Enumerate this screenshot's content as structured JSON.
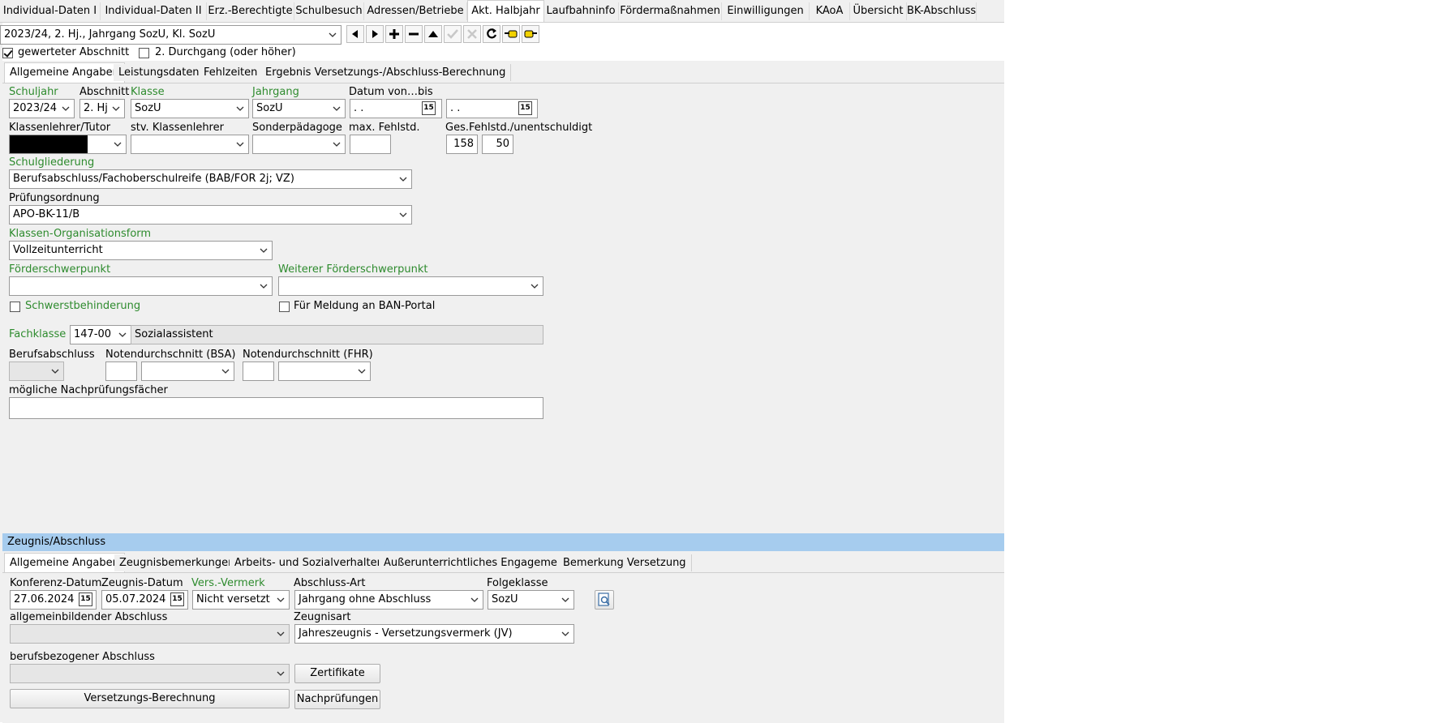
{
  "top_tabs": [
    "Individual-Daten I",
    "Individual-Daten II",
    "Erz.-Berechtigte",
    "Schulbesuch",
    "Adressen/Betriebe",
    "Akt. Halbjahr",
    "Laufbahninfo",
    "Fördermaßnahmen",
    "Einwilligungen",
    "KAoA",
    "Übersicht",
    "BK-Abschluss"
  ],
  "active_top_tab": "Akt. Halbjahr",
  "period_select": "2023/24, 2. Hj., Jahrgang SozU, Kl. SozU",
  "checks": {
    "gewerteter_label": "gewerteter Abschnitt",
    "gewerteter_checked": true,
    "durchgang_label": "2. Durchgang (oder höher)",
    "durchgang_checked": false
  },
  "sub_tabs": [
    "Allgemeine Angaben",
    "Leistungsdaten",
    "Fehlzeiten",
    "Ergebnis Versetzungs-/Abschluss-Berechnung"
  ],
  "general": {
    "schuljahr_label": "Schuljahr",
    "schuljahr": "2023/24",
    "abschnitt_label": "Abschnitt",
    "abschnitt": "2. Hj",
    "klasse_label": "Klasse",
    "klasse": "SozU",
    "jahrgang_label": "Jahrgang",
    "jahrgang": "SozU",
    "datum_label": "Datum von…bis",
    "datum_von": " .  .",
    "datum_bis": " .  .",
    "klassenlehrer_label": "Klassenlehrer/Tutor",
    "stv_label": "stv. Klassenlehrer",
    "sonder_label": "Sonderpädagoge",
    "maxfehl_label": "max. Fehlstd.",
    "gesfehl_label": "Ges.Fehlstd./unentschuldigt",
    "gesfehl": "158",
    "unentschuldigt": "50",
    "schulgliederung_label": "Schulgliederung",
    "schulgliederung": "Berufsabschluss/Fachoberschulreife (BAB/FOR 2j; VZ)",
    "pruefungsordnung_label": "Prüfungsordnung",
    "pruefungsordnung": "APO-BK-11/B",
    "orgform_label": "Klassen-Organisationsform",
    "orgform": "Vollzeitunterricht",
    "foerder_label": "Förderschwerpunkt",
    "weiterer_foerder_label": "Weiterer Förderschwerpunkt",
    "schwerst_label": "Schwerstbehinderung",
    "ban_label": "Für Meldung an BAN-Portal",
    "fachklasse_label": "Fachklasse",
    "fachklasse_code": "147-00",
    "fachklasse_name": "Sozialassistent",
    "berufsabschluss_label": "Berufsabschluss",
    "notenbsa_label": "Notendurchschnitt (BSA)",
    "notenfhr_label": "Notendurchschnitt (FHR)",
    "nachpruef_label": "mögliche Nachprüfungsfächer"
  },
  "zeugnis": {
    "header": "Zeugnis/Abschluss",
    "tabs": [
      "Allgemeine Angaben",
      "Zeugnisbemerkungen",
      "Arbeits- und Sozialverhalten",
      "Außerunterrichtliches Engagement",
      "Bemerkung Versetzung"
    ],
    "konferenz_label": "Konferenz-Datum",
    "konferenz": "27.06.2024",
    "zeugnisdatum_label": "Zeugnis-Datum",
    "zeugnisdatum": "05.07.2024",
    "vermerk_label": "Vers.-Vermerk",
    "vermerk": "Nicht versetzt",
    "abschlussart_label": "Abschluss-Art",
    "abschlussart": "Jahrgang ohne Abschluss",
    "folgeklasse_label": "Folgeklasse",
    "folgeklasse": "SozU",
    "allg_abschluss_label": "allgemeinbildender Abschluss",
    "zeugnisart_label": "Zeugnisart",
    "zeugnisart": "Jahreszeugnis - Versetzungsvermerk (JV)",
    "beruf_abschluss_label": "berufsbezogener Abschluss",
    "zertifikate_btn": "Zertifikate",
    "versetzung_btn": "Versetzungs-Berechnung",
    "nachpruefungen_btn": "Nachprüfungen"
  },
  "icons": [
    "first-icon",
    "next-icon",
    "add-icon",
    "remove-icon",
    "up-icon",
    "check-icon",
    "cancel-icon",
    "refresh-icon",
    "hand-left-icon",
    "hand-right-icon",
    "calendar-icon",
    "search-doc-icon"
  ]
}
